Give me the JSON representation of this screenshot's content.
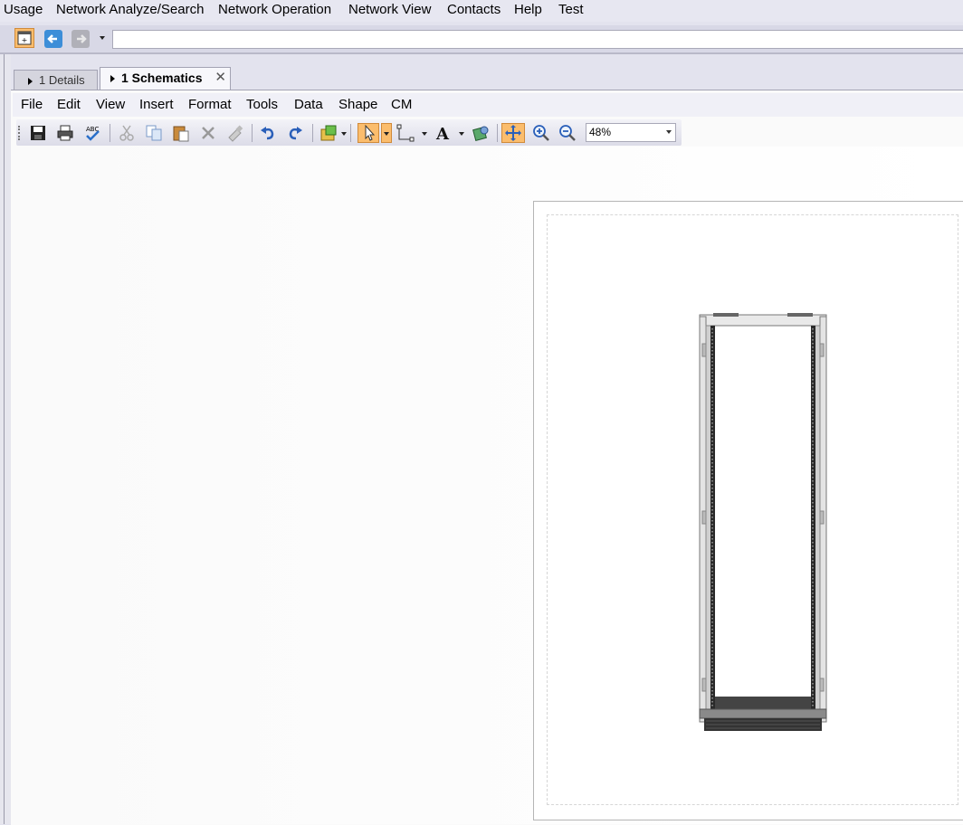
{
  "top_menu": [
    "Usage",
    "Network Analyze/Search",
    "Network Operation",
    "Network View",
    "Contacts",
    "Help",
    "Test"
  ],
  "address_bar": {
    "value": ""
  },
  "tabs": [
    {
      "label": "1 Details",
      "active": false
    },
    {
      "label": "1 Schematics",
      "active": true
    }
  ],
  "doc_menu": [
    "File",
    "Edit",
    "View",
    "Insert",
    "Format",
    "Tools",
    "Data",
    "Shape",
    "CM"
  ],
  "zoom": {
    "value": "48%"
  },
  "colors": {
    "highlight": "#fbbd6d",
    "toolbar_bg": "#d8d8e6"
  }
}
